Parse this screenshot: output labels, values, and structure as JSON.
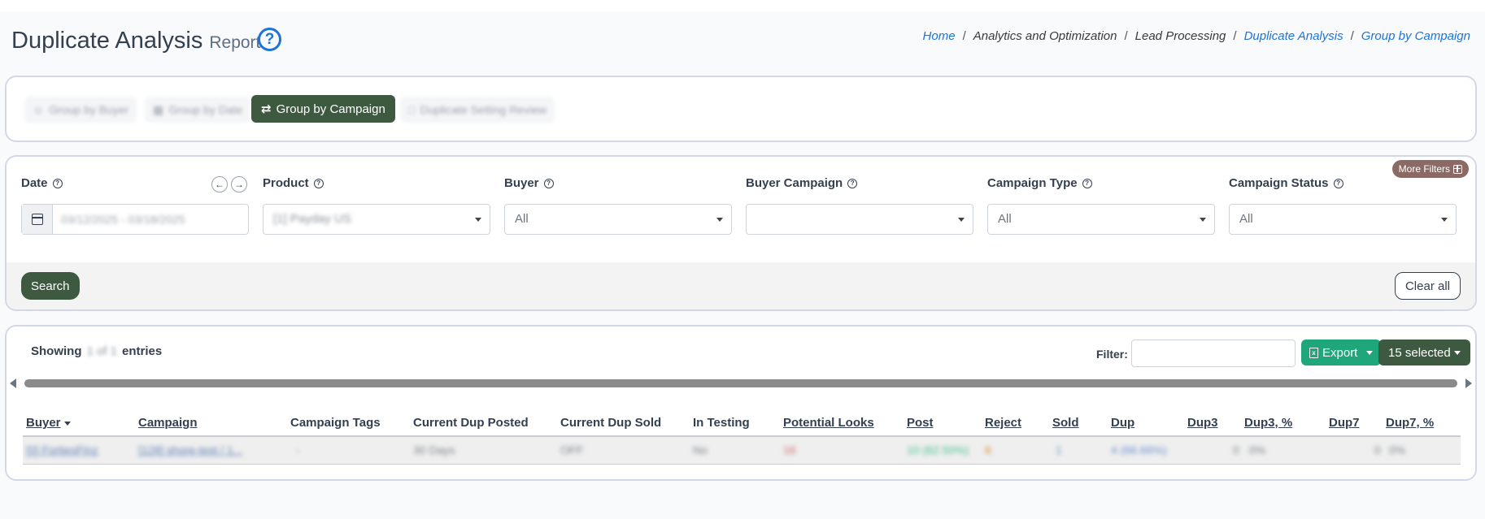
{
  "header": {
    "title": "Duplicate Analysis",
    "subtitle": "Report",
    "help_glyph": "?",
    "breadcrumb": [
      "Home",
      "Analytics and Optimization",
      "Lead Processing",
      "Duplicate Analysis",
      "Group by Campaign"
    ],
    "breadcrumb_sep": "/"
  },
  "nav": {
    "group_by_buyer": "Group by Buyer",
    "group_by_date": "Group by Date",
    "group_by_campaign": "Group by Campaign",
    "duplicate_review": "Duplicate Setting Review"
  },
  "filters": {
    "more_filters": "More Filters",
    "date_label": "Date",
    "date_value": "03/12/2025 - 03/18/2025",
    "product_label": "Product",
    "product_value": "[1] Payday US",
    "buyer_label": "Buyer",
    "buyer_value": "All",
    "buyer_campaign_label": "Buyer Campaign",
    "buyer_campaign_value": "",
    "campaign_type_label": "Campaign Type",
    "campaign_type_value": "All",
    "campaign_status_label": "Campaign Status",
    "campaign_status_value": "All",
    "search": "Search",
    "clear_all": "Clear all",
    "arrow_prev": "←",
    "arrow_next": "→"
  },
  "table": {
    "showing_prefix": "Showing",
    "showing_count": "1 of 1",
    "showing_suffix": "entries",
    "filter_label": "Filter:",
    "filter_value": "",
    "export": "Export",
    "selected": "15 selected",
    "columns": [
      "Buyer",
      "Campaign",
      "Campaign Tags",
      "Current Dup Posted",
      "Current Dup Sold",
      "In Testing",
      "Potential Looks",
      "Post",
      "Reject",
      "Sold",
      "Dup",
      "Dup3",
      "Dup3, %",
      "Dup7",
      "Dup7, %"
    ],
    "row": [
      "[0] FortiesFinz",
      "[128] shore-test / 1...",
      "-",
      "30 Days",
      "OFF",
      "No",
      "16",
      "10 (62.50%)",
      "6",
      "1",
      "4 (66.66%)",
      "0",
      "0%",
      "0",
      "0%"
    ]
  },
  "colors": {
    "primary_green": "#3d5a40",
    "export_green": "#1fa67a",
    "link_blue": "#1e73d9",
    "more_filters_bg": "#8b6a66"
  }
}
